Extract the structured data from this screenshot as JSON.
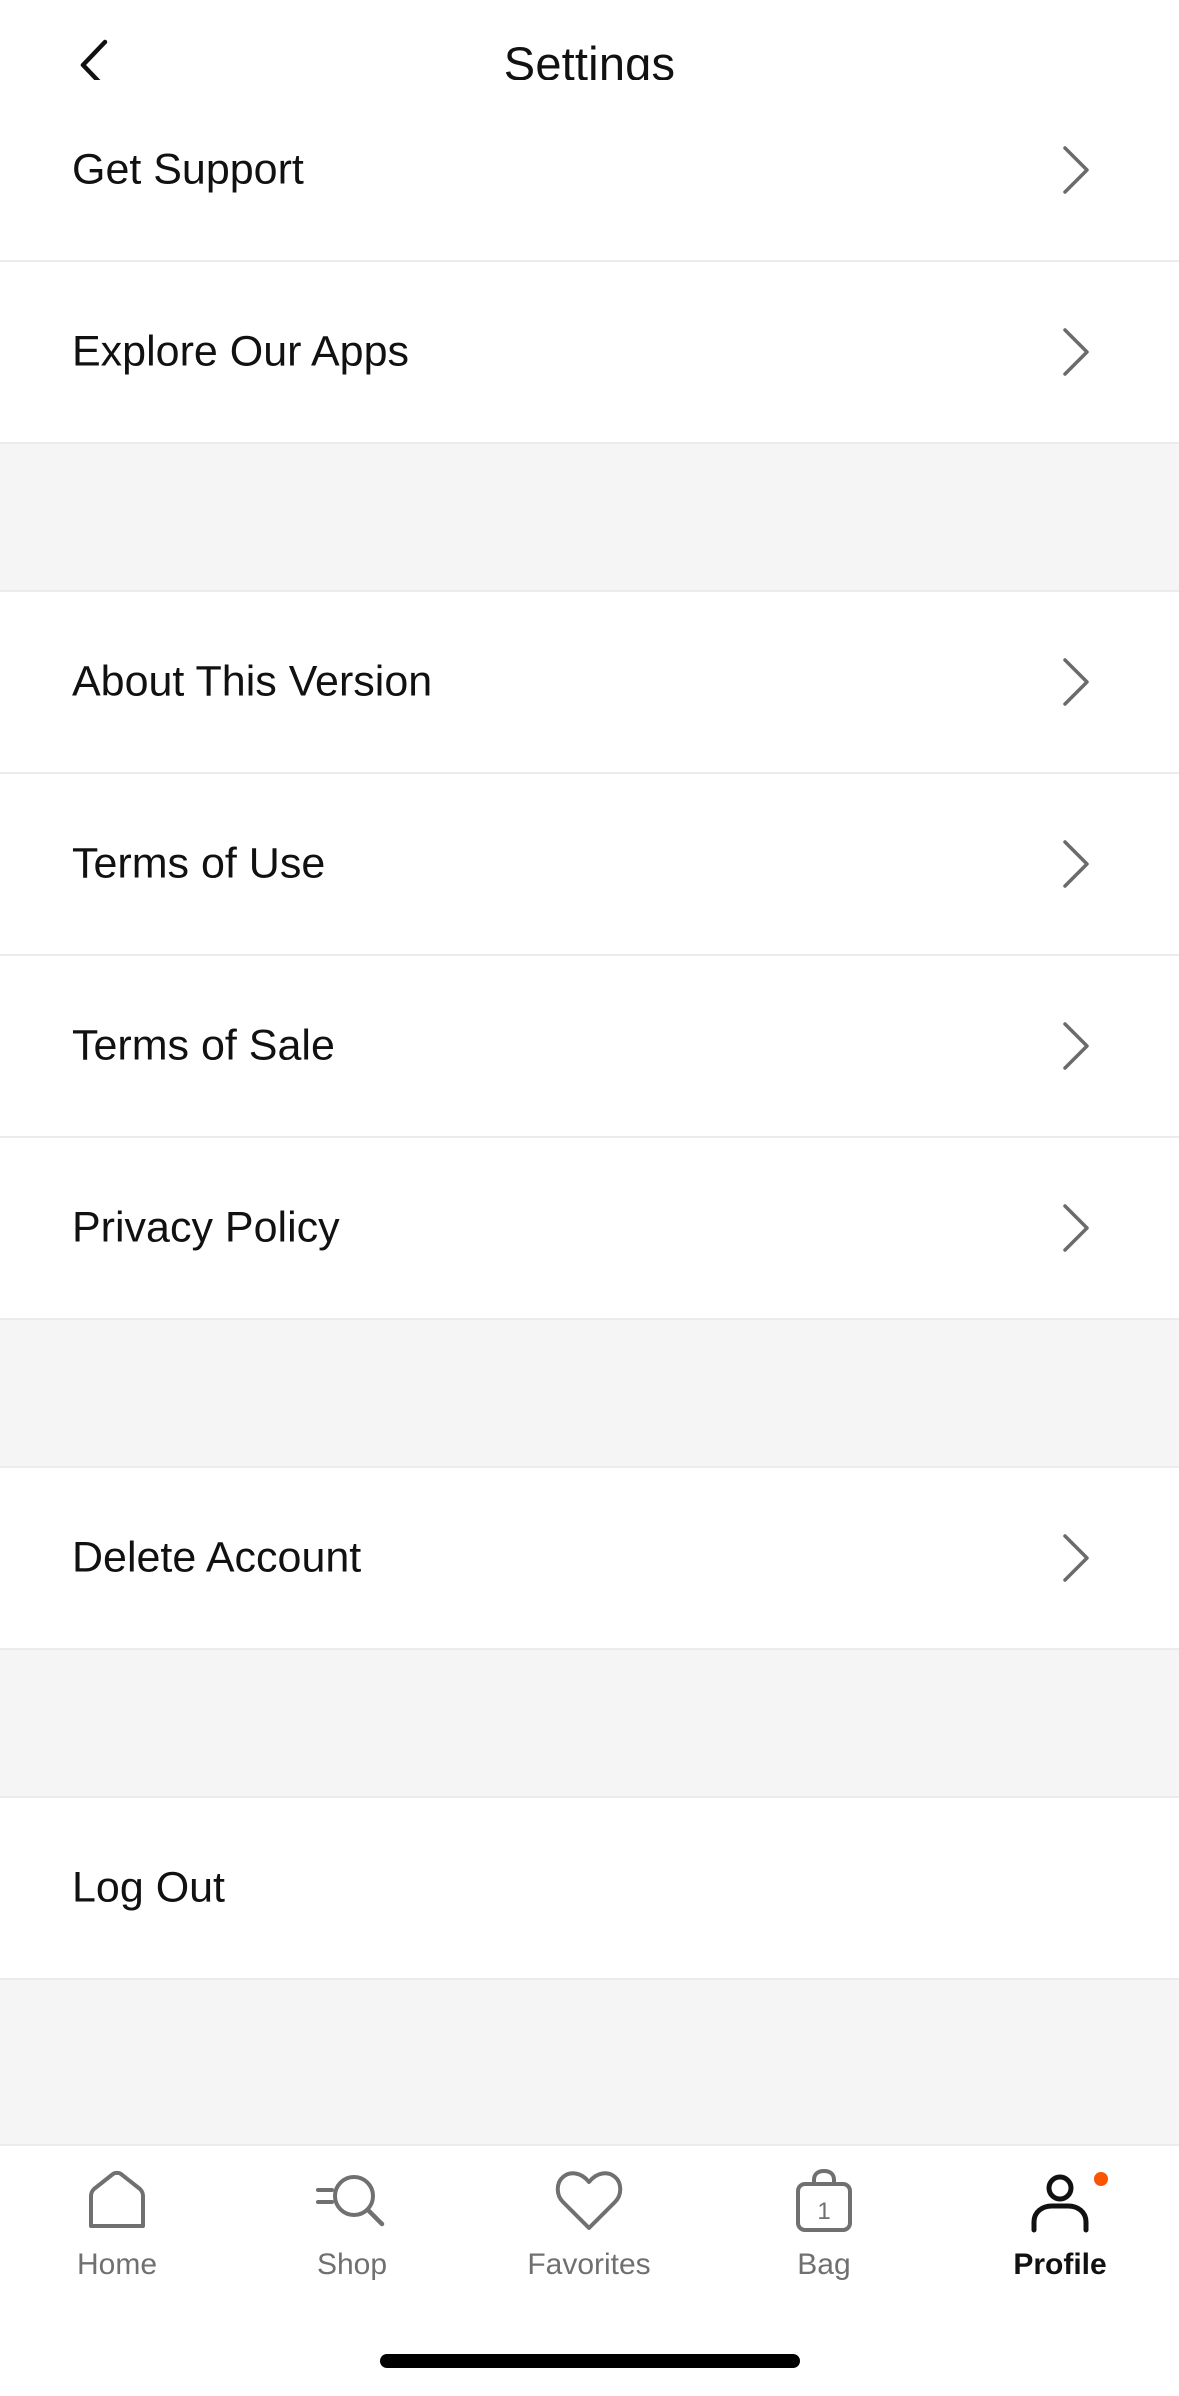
{
  "header": {
    "title": "Settings"
  },
  "rows": {
    "get_support": "Get Support",
    "explore_apps": "Explore Our Apps",
    "about_version": "About This Version",
    "terms_use": "Terms of Use",
    "terms_sale": "Terms of Sale",
    "privacy": "Privacy Policy",
    "delete_account": "Delete Account",
    "log_out": "Log Out"
  },
  "tabbar": {
    "home": "Home",
    "shop": "Shop",
    "favorites": "Favorites",
    "bag": "Bag",
    "bag_count": "1",
    "profile": "Profile",
    "active": "profile"
  },
  "colors": {
    "accent_dot": "#fa5400",
    "section_gap": "#f5f5f5",
    "divider": "#ececec"
  }
}
